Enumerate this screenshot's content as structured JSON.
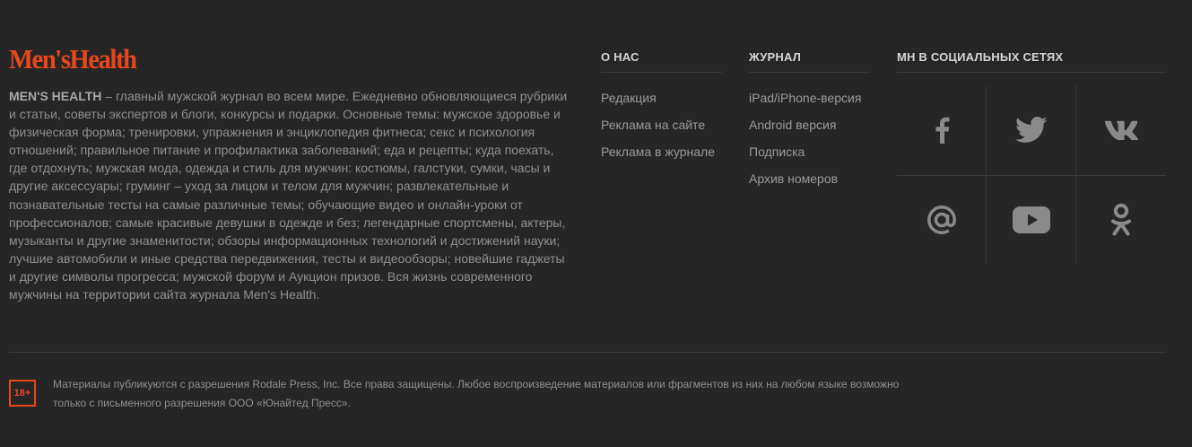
{
  "brand": {
    "logo_text": "Men'sHealth",
    "accent_color": "#e8471c"
  },
  "about": {
    "lead": "MEN'S HEALTH",
    "text": " – главный мужской журнал во всем мире. Ежедневно обновляющиеся рубрики и статьи, советы экспертов и блоги, конкурсы и подарки. Основные темы: мужское здоровье и физическая форма; тренировки, упражнения и энциклопедия фитнеса; секс и психология отношений; правильное питание и профилактика заболеваний; еда и рецепты; куда поехать, где отдохнуть; мужская мода, одежда и стиль для мужчин: костюмы, галстуки, сумки, часы и другие аксессуары; груминг – уход за лицом и телом для мужчин; развлекательные и познавательные тесты на самые различные темы; обучающие видео и онлайн-уроки от профессионалов; самые красивые девушки в одежде и без; легендарные спортсмены, актеры, музыканты и другие знаменитости; обзоры информационных технологий и достижений науки; лучшие автомобили и иные средства передвижения, тесты и видеообзоры; новейшие гаджеты и другие символы прогресса; мужской форум и Аукцион призов. Вся жизнь современного мужчины на территории сайта журнала Men's Health."
  },
  "columns": {
    "about_us": {
      "title": "О НАС",
      "items": [
        "Редакция",
        "Реклама на сайте",
        "Реклама в журнале"
      ]
    },
    "magazine": {
      "title": "ЖУРНАЛ",
      "items": [
        "iPad/iPhone-версия",
        "Android версия",
        "Подписка",
        "Архив номеров"
      ]
    },
    "social": {
      "title": "MH В СОЦИАЛЬНЫХ СЕТЯХ",
      "icons": [
        "facebook-icon",
        "twitter-icon",
        "vk-icon",
        "mail-ru-icon",
        "youtube-icon",
        "odnoklassniki-icon"
      ],
      "icon_color": "#8a8a8a"
    }
  },
  "footer": {
    "age_badge": "18+",
    "copyright_line1": "Материалы публикуются с разрешения Rodale Press, Inc. Все права защищены. Любое воспроизведение материалов или фрагментов из них на любом языке возможно",
    "copyright_line2": "только с письменного разрешения ООО «Юнайтед Пресс»."
  }
}
